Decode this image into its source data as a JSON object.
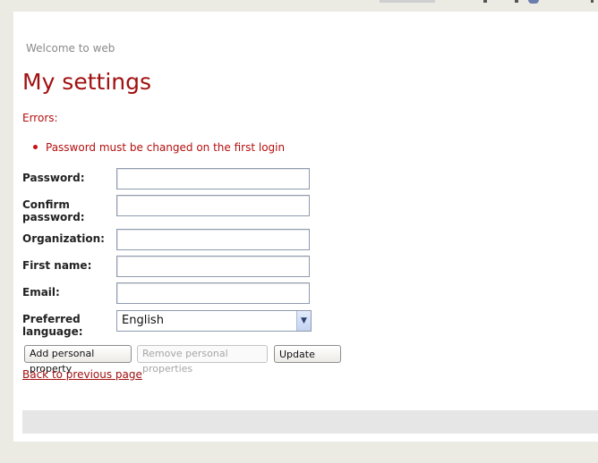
{
  "page": {
    "welcome": "Welcome to web",
    "title": "My settings"
  },
  "errors": {
    "label": "Errors:",
    "items": [
      "Password must be changed on the first login"
    ]
  },
  "form": {
    "fields": [
      {
        "label": "Password:",
        "value": ""
      },
      {
        "label": "Confirm password:",
        "value": ""
      },
      {
        "label": "Organization:",
        "value": ""
      },
      {
        "label": "First name:",
        "value": ""
      },
      {
        "label": "Email:",
        "value": ""
      }
    ],
    "language": {
      "label": "Preferred language:",
      "selected": "English"
    }
  },
  "buttons": {
    "add_property": "Add personal property",
    "remove_properties": "Remove personal properties",
    "update": "Update"
  },
  "links": {
    "back": "Back to previous page"
  },
  "colors": {
    "accent": "#a11010",
    "error": "#b41010"
  }
}
